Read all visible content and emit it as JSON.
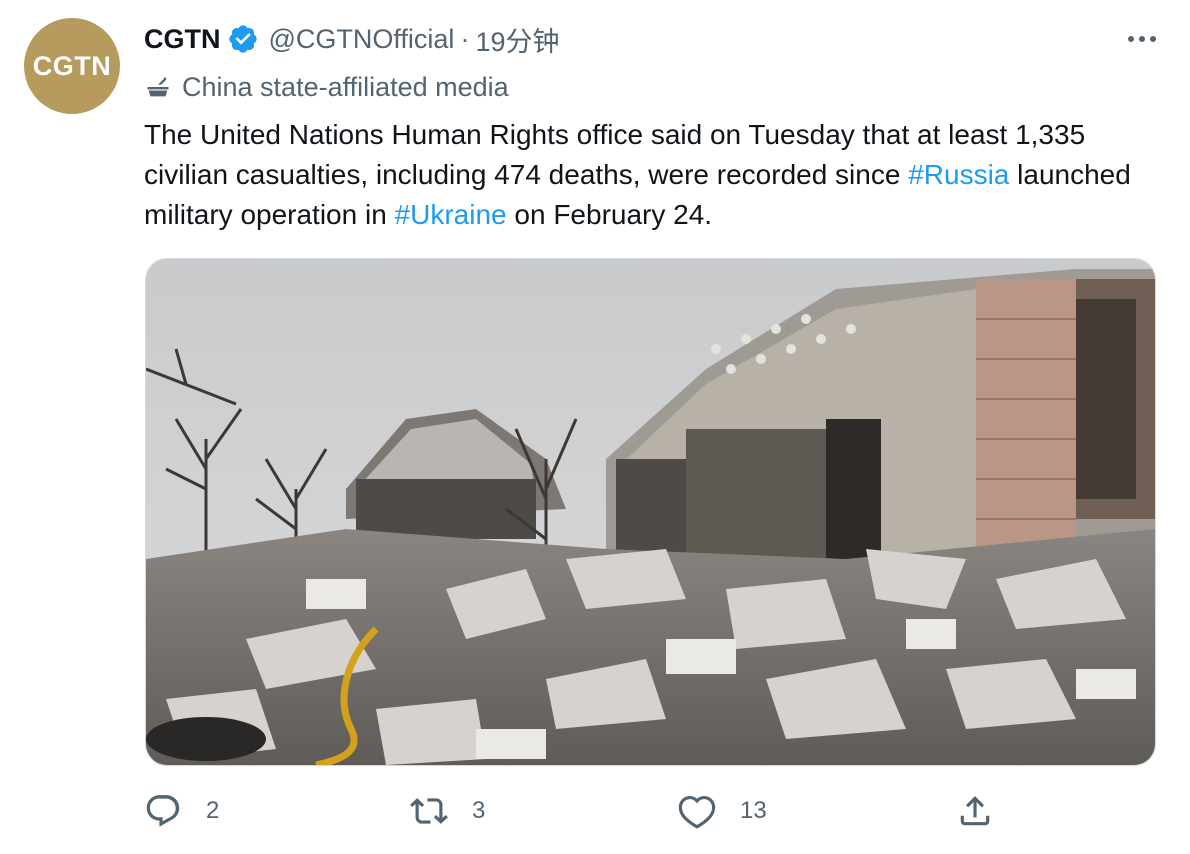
{
  "author": {
    "avatar_text": "CGTN",
    "display_name": "CGTN",
    "handle": "@CGTNOfficial",
    "separator": "·",
    "timestamp": "19分钟",
    "verified": true,
    "label": "China state-affiliated media"
  },
  "tweet": {
    "text_part1": "The United Nations Human Rights office said on Tuesday that at least 1,335 civilian casualties, including 474 deaths, were recorded since ",
    "hashtag1": "#Russia",
    "text_part2": " launched military operation in ",
    "hashtag2": "#Ukraine",
    "text_part3": " on February 24."
  },
  "media": {
    "type": "photo",
    "subject": "destroyed-building-rubble"
  },
  "actions": {
    "reply_count": "2",
    "retweet_count": "3",
    "like_count": "13"
  },
  "icons": {
    "verified": "verified-badge-icon",
    "label": "state-media-icon",
    "more": "more-options-icon",
    "reply": "reply-icon",
    "retweet": "retweet-icon",
    "like": "like-icon",
    "share": "share-icon"
  },
  "colors": {
    "link": "#1d9bf0",
    "secondary_text": "#536471",
    "avatar_bg": "#b79b5e"
  }
}
